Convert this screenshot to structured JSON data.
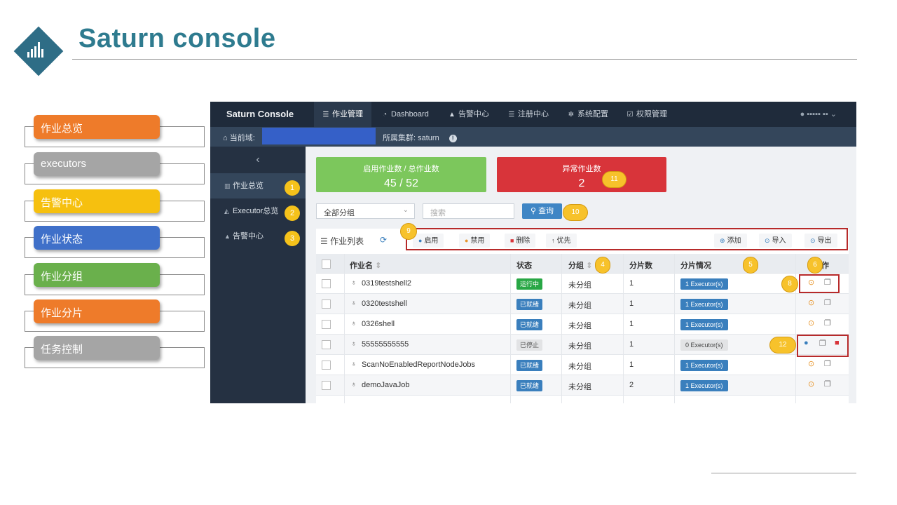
{
  "slide": {
    "title": "Saturn console"
  },
  "legend": [
    {
      "label": "作业总览",
      "color": "#ee7b2a"
    },
    {
      "label": "executors",
      "color": "#a5a5a5"
    },
    {
      "label": "告警中心",
      "color": "#f6c00f"
    },
    {
      "label": "作业状态",
      "color": "#3f70c9"
    },
    {
      "label": "作业分组",
      "color": "#6ab04c"
    },
    {
      "label": "作业分片",
      "color": "#ee7b2a"
    },
    {
      "label": "任务控制",
      "color": "#a5a5a5"
    }
  ],
  "app": {
    "brand": "Saturn Console",
    "nav": [
      {
        "label": "作业管理",
        "icon": "list-icon"
      },
      {
        "label": "Dashboard",
        "icon": "pie-chart-icon"
      },
      {
        "label": "告警中心",
        "icon": "bell-icon"
      },
      {
        "label": "注册中心",
        "icon": "list-icon"
      },
      {
        "label": "系统配置",
        "icon": "gear-icon"
      },
      {
        "label": "权限管理",
        "icon": "check-square-icon"
      }
    ],
    "domain_label": "当前域:",
    "cluster_label": "所属集群: saturn",
    "sidebar": [
      {
        "label": "作业总览",
        "badge": "1"
      },
      {
        "label": "Executor总览",
        "badge": "2"
      },
      {
        "label": "告警中心",
        "badge": "3"
      }
    ],
    "cards": {
      "enabled_label": "启用作业数 / 总作业数",
      "enabled_value": "45 / 52",
      "abnormal_label": "异常作业数",
      "abnormal_value": "2",
      "success_color": "#7cc75c",
      "danger_color": "#d8343a"
    },
    "filters": {
      "group_select": "全部分组",
      "search_placeholder": "搜索",
      "query_button": "查询"
    },
    "table_panel": {
      "title": "作业列表",
      "actions_left": [
        "启用",
        "禁用",
        "删除",
        "优先"
      ],
      "actions_right": [
        "添加",
        "导入",
        "导出"
      ]
    },
    "columns": [
      "作业名",
      "状态",
      "分组",
      "分片数",
      "分片情况",
      "操作"
    ],
    "rows": [
      {
        "name": "0319testshell2",
        "status": "运行中",
        "status_color": "#28a745",
        "group": "未分组",
        "shards": "1",
        "exec": "1 Executor(s)",
        "exec_active": true
      },
      {
        "name": "0320testshell",
        "status": "已就绪",
        "status_color": "#3a7fbd",
        "group": "未分组",
        "shards": "1",
        "exec": "1 Executor(s)",
        "exec_active": true
      },
      {
        "name": "0326shell",
        "status": "已就绪",
        "status_color": "#3a7fbd",
        "group": "未分组",
        "shards": "1",
        "exec": "1 Executor(s)",
        "exec_active": true
      },
      {
        "name": "55555555555",
        "status": "已停止",
        "status_color": "#e2e3e5",
        "group": "未分组",
        "shards": "1",
        "exec": "0 Executor(s)",
        "exec_active": false
      },
      {
        "name": "ScanNoEnabledReportNodeJobs",
        "status": "已就绪",
        "status_color": "#3a7fbd",
        "group": "未分组",
        "shards": "1",
        "exec": "1 Executor(s)",
        "exec_active": true
      },
      {
        "name": "demoJavaJob",
        "status": "已就绪",
        "status_color": "#3a7fbd",
        "group": "未分组",
        "shards": "2",
        "exec": "1 Executor(s)",
        "exec_active": true
      }
    ],
    "callouts": [
      "4",
      "5",
      "6",
      "7",
      "8",
      "9",
      "10",
      "11",
      "12"
    ]
  }
}
